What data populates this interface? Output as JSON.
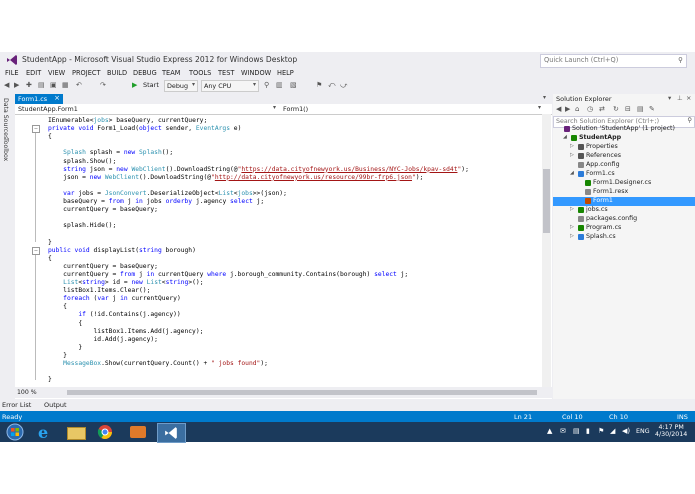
{
  "window": {
    "title": "StudentApp - Microsoft Visual Studio Express 2012 for Windows Desktop",
    "quick_launch_placeholder": "Quick Launch (Ctrl+Q)"
  },
  "menu": [
    "FILE",
    "EDIT",
    "VIEW",
    "PROJECT",
    "BUILD",
    "DEBUG",
    "TEAM",
    "TOOLS",
    "TEST",
    "WINDOW",
    "HELP"
  ],
  "toolbar": {
    "start_label": "Start",
    "config_value": "Debug",
    "platform_value": "Any CPU"
  },
  "left_strip": [
    "Data Sources",
    "Toolbox"
  ],
  "editor": {
    "tab_label": "Form1.cs",
    "nav_left": "StudentApp.Form1",
    "nav_right": "Form1()",
    "zoom": "100 %"
  },
  "code_lines": [
    [
      [
        "",
        "IEnumerable<"
      ],
      [
        "ty",
        "jobs"
      ],
      [
        "",
        "> baseQuery, currentQuery;"
      ]
    ],
    [
      [
        "kw",
        "private void "
      ],
      [
        "",
        "Form1_Load("
      ],
      [
        "kw",
        "object"
      ],
      [
        "",
        " sender, "
      ],
      [
        "ty",
        "EventArgs"
      ],
      [
        "",
        " e)"
      ]
    ],
    [
      [
        "",
        "{"
      ]
    ],
    [
      [
        "",
        ""
      ]
    ],
    [
      [
        "",
        "    "
      ],
      [
        "ty",
        "Splash"
      ],
      [
        "",
        " splash = "
      ],
      [
        "kw",
        "new "
      ],
      [
        "ty",
        "Splash"
      ],
      [
        "",
        "();"
      ]
    ],
    [
      [
        "",
        "    splash.Show();"
      ]
    ],
    [
      [
        "",
        "    "
      ],
      [
        "kw",
        "string"
      ],
      [
        "",
        " json = "
      ],
      [
        "kw",
        "new "
      ],
      [
        "ty",
        "WebClient"
      ],
      [
        "",
        "().DownloadString(@"
      ],
      [
        "st",
        "\""
      ],
      [
        "ul",
        "https://data.cityofnewyork.us/Business/NYC-Jobs/kpav-sd4t"
      ],
      [
        "st",
        "\""
      ],
      [
        "",
        ");"
      ]
    ],
    [
      [
        "",
        "    json = "
      ],
      [
        "kw",
        "new "
      ],
      [
        "ty",
        "WebClient"
      ],
      [
        "",
        "().DownloadString(@"
      ],
      [
        "st",
        "\""
      ],
      [
        "ul",
        "http://data.cityofnewyork.us/resource/99br-frp6.json"
      ],
      [
        "st",
        "\""
      ],
      [
        "",
        ");"
      ]
    ],
    [
      [
        "",
        ""
      ]
    ],
    [
      [
        "",
        "    "
      ],
      [
        "kw",
        "var"
      ],
      [
        "",
        " jobs = "
      ],
      [
        "ty",
        "JsonConvert"
      ],
      [
        "",
        ".DeserializeObject<"
      ],
      [
        "ty",
        "List"
      ],
      [
        "",
        "<"
      ],
      [
        "ty",
        "jobs"
      ],
      [
        "",
        ">>(json);"
      ]
    ],
    [
      [
        "",
        "    baseQuery = "
      ],
      [
        "kw",
        "from"
      ],
      [
        "",
        " j "
      ],
      [
        "kw",
        "in"
      ],
      [
        "",
        " jobs "
      ],
      [
        "kw",
        "orderby"
      ],
      [
        "",
        " j.agency "
      ],
      [
        "kw",
        "select"
      ],
      [
        "",
        " j;"
      ]
    ],
    [
      [
        "",
        "    currentQuery = baseQuery;"
      ]
    ],
    [
      [
        "",
        ""
      ]
    ],
    [
      [
        "",
        "    splash.Hide();"
      ]
    ],
    [
      [
        "",
        ""
      ]
    ],
    [
      [
        "",
        "}"
      ]
    ],
    [
      [
        "kw",
        "public void "
      ],
      [
        "",
        "displayList("
      ],
      [
        "kw",
        "string"
      ],
      [
        "",
        " borough)"
      ]
    ],
    [
      [
        "",
        "{"
      ]
    ],
    [
      [
        "",
        "    currentQuery = baseQuery;"
      ]
    ],
    [
      [
        "",
        "    currentQuery = "
      ],
      [
        "kw",
        "from"
      ],
      [
        "",
        " j "
      ],
      [
        "kw",
        "in"
      ],
      [
        "",
        " currentQuery "
      ],
      [
        "kw",
        "where"
      ],
      [
        "",
        " j.borough_community.Contains(borough) "
      ],
      [
        "kw",
        "select"
      ],
      [
        "",
        " j;"
      ]
    ],
    [
      [
        "",
        "    "
      ],
      [
        "ty",
        "List"
      ],
      [
        "",
        "<"
      ],
      [
        "kw",
        "string"
      ],
      [
        "",
        "> id = "
      ],
      [
        "kw",
        "new "
      ],
      [
        "ty",
        "List"
      ],
      [
        "",
        "<"
      ],
      [
        "kw",
        "string"
      ],
      [
        "",
        ">();"
      ]
    ],
    [
      [
        "",
        "    listBox1.Items.Clear();"
      ]
    ],
    [
      [
        "",
        "    "
      ],
      [
        "kw",
        "foreach"
      ],
      [
        "",
        " ("
      ],
      [
        "kw",
        "var"
      ],
      [
        "",
        " j "
      ],
      [
        "kw",
        "in"
      ],
      [
        "",
        " currentQuery)"
      ]
    ],
    [
      [
        "",
        "    {"
      ]
    ],
    [
      [
        "",
        "        "
      ],
      [
        "kw",
        "if"
      ],
      [
        "",
        " (!id.Contains(j.agency))"
      ]
    ],
    [
      [
        "",
        "        {"
      ]
    ],
    [
      [
        "",
        "            listBox1.Items.Add(j.agency);"
      ]
    ],
    [
      [
        "",
        "            id.Add(j.agency);"
      ]
    ],
    [
      [
        "",
        "        }"
      ]
    ],
    [
      [
        "",
        "    }"
      ]
    ],
    [
      [
        "",
        "    "
      ],
      [
        "ty",
        "MessageBox"
      ],
      [
        "",
        ".Show(currentQuery.Count() + "
      ],
      [
        "st",
        "\" jobs found\""
      ],
      [
        "",
        ");"
      ]
    ],
    [
      [
        "",
        ""
      ]
    ],
    [
      [
        "",
        "}"
      ]
    ]
  ],
  "solution_explorer": {
    "title": "Solution Explorer",
    "search_placeholder": "Search Solution Explorer (Ctrl+;)",
    "items": [
      {
        "label": "Solution 'StudentApp' (1 project)",
        "indent": 0,
        "arrow": "",
        "color": "#68217a"
      },
      {
        "label": "StudentApp",
        "indent": 1,
        "arrow": "◢",
        "color": "#178600",
        "bold": true
      },
      {
        "label": "Properties",
        "indent": 2,
        "arrow": "▷",
        "color": "#555555"
      },
      {
        "label": "References",
        "indent": 2,
        "arrow": "▷",
        "color": "#555555"
      },
      {
        "label": "App.config",
        "indent": 2,
        "arrow": "",
        "color": "#888888"
      },
      {
        "label": "Form1.cs",
        "indent": 2,
        "arrow": "◢",
        "color": "#2b7bd9"
      },
      {
        "label": "Form1.Designer.cs",
        "indent": 3,
        "arrow": "",
        "color": "#178600"
      },
      {
        "label": "Form1.resx",
        "indent": 3,
        "arrow": "",
        "color": "#888888"
      },
      {
        "label": "Form1",
        "indent": 3,
        "arrow": "",
        "color": "#c24b00",
        "selected": true
      },
      {
        "label": "jobs.cs",
        "indent": 2,
        "arrow": "▷",
        "color": "#178600"
      },
      {
        "label": "packages.config",
        "indent": 2,
        "arrow": "",
        "color": "#888888"
      },
      {
        "label": "Program.cs",
        "indent": 2,
        "arrow": "▷",
        "color": "#178600"
      },
      {
        "label": "Splash.cs",
        "indent": 2,
        "arrow": "▷",
        "color": "#2b7bd9"
      }
    ]
  },
  "bottom_tabs": [
    "Error List",
    "Output"
  ],
  "status": {
    "ready": "Ready",
    "ln": "Ln 21",
    "col": "Col 10",
    "ch": "Ch 10",
    "ins": "INS"
  },
  "taskbar": {
    "lang": "ENG",
    "time": "4:17 PM",
    "date": "4/30/2014"
  },
  "colors": {
    "accent": "#007acc",
    "taskbar": "#1b3a5c",
    "selection": "#3399ff"
  }
}
